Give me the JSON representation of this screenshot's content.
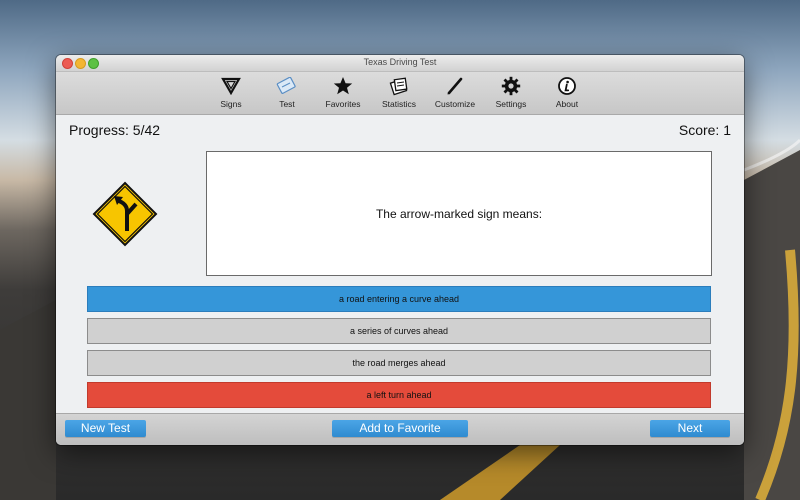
{
  "window": {
    "title": "Texas Driving Test"
  },
  "toolbar": {
    "items": [
      {
        "label": "Signs",
        "icon": "yield-triangle-icon"
      },
      {
        "label": "Test",
        "icon": "test-book-icon"
      },
      {
        "label": "Favorites",
        "icon": "star-icon"
      },
      {
        "label": "Statistics",
        "icon": "statistics-icon"
      },
      {
        "label": "Customize",
        "icon": "pen-icon"
      },
      {
        "label": "Settings",
        "icon": "gear-icon"
      },
      {
        "label": "About",
        "icon": "info-icon"
      }
    ]
  },
  "status": {
    "progress": "Progress: 5/42",
    "score": "Score: 1"
  },
  "question": {
    "text": "The arrow-marked sign means:",
    "sign_icon": "road-entering-curve-sign-icon"
  },
  "answers": [
    {
      "text": "a road entering a curve ahead",
      "state": "selected"
    },
    {
      "text": "a series of curves ahead",
      "state": "neutral"
    },
    {
      "text": "the road merges ahead",
      "state": "neutral"
    },
    {
      "text": "a left turn ahead",
      "state": "wrong"
    }
  ],
  "bottom": {
    "new_test": "New Test",
    "add_favorite": "Add to Favorite",
    "next": "Next"
  },
  "colors": {
    "selected": "#3596d9",
    "wrong": "#e44b3b",
    "neutral": "#d0d0d0",
    "button": "#3596d9",
    "sign_yellow": "#f7c500"
  }
}
